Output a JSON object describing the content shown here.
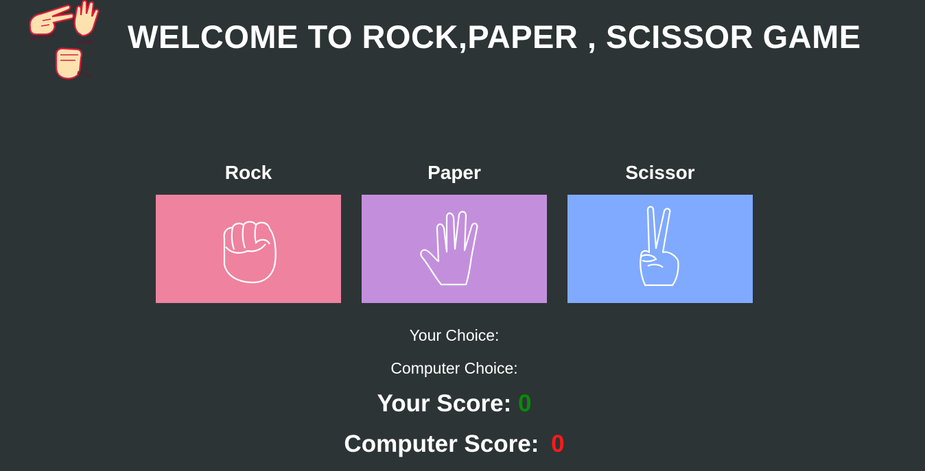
{
  "header": {
    "title": "WELCOME TO ROCK,PAPER , SCISSOR GAME",
    "logo_labels": {
      "scissors": "SCISSORS",
      "paper": "PAPER",
      "rock": "ROCK"
    }
  },
  "choices": [
    {
      "label": "Rock",
      "color": "#ef829f",
      "icon": "fist-icon"
    },
    {
      "label": "Paper",
      "color": "#c38fdc",
      "icon": "open-hand-icon"
    },
    {
      "label": "Scissor",
      "color": "#80aaff",
      "icon": "peace-hand-icon"
    }
  ],
  "status": {
    "your_choice_label": "Your Choice:",
    "your_choice_value": "",
    "computer_choice_label": "Computer Choice:",
    "computer_choice_value": ""
  },
  "scores": {
    "your_score_label": "Your Score:",
    "your_score": "0",
    "your_score_color": "#0a8a0a",
    "computer_score_label": "Computer Score:",
    "computer_score": "0",
    "computer_score_color": "#ff1a1a"
  }
}
